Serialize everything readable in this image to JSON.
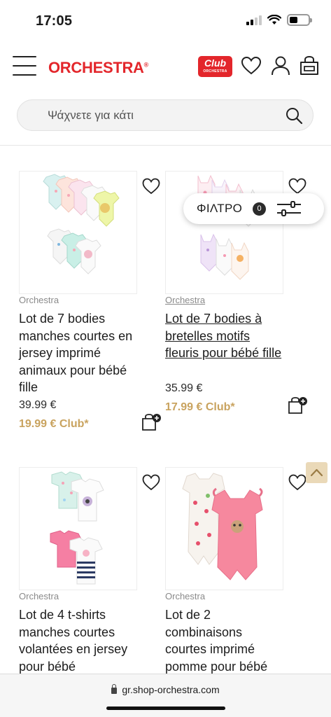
{
  "status_bar": {
    "time": "17:05",
    "battery_level": 0.42
  },
  "header": {
    "brand": "ORCHESTRA",
    "brand_mark": "®",
    "club_badge": {
      "main": "Club",
      "sub": "ORCHESTRA"
    },
    "icons": [
      "menu-icon",
      "heart-icon",
      "user-icon",
      "cart-icon"
    ]
  },
  "search": {
    "placeholder": "Ψάχνετε για κάτι"
  },
  "filter": {
    "label": "ΦΙΛΤΡΟ",
    "count": "0"
  },
  "products": [
    {
      "brand": "Orchestra",
      "title": "Lot de 7 bodies manches courtes en jersey imprimé animaux pour bébé fille",
      "price": "39.99 €",
      "club_price": "19.99 € Club*"
    },
    {
      "brand": "Orchestra",
      "title": "Lot de 7 bodies à bretelles motifs fleuris pour bébé fille",
      "price": "35.99 €",
      "club_price": "17.99 € Club*"
    },
    {
      "brand": "Orchestra",
      "title": "Lot de 4 t-shirts manches courtes volantées en jersey pour bébé"
    },
    {
      "brand": "Orchestra",
      "title": "Lot de 2 combinaisons courtes imprimé pomme pour bébé"
    }
  ],
  "colors": {
    "brand_red": "#e3262b",
    "club_gold": "#c9a35f",
    "back_to_top": "#ead9b8"
  },
  "browser": {
    "url": "gr.shop-orchestra.com"
  }
}
